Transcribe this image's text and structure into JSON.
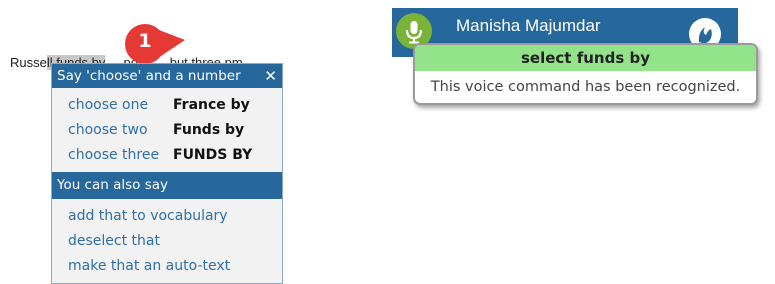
{
  "document": {
    "text_before": "Russe",
    "text_highlight": "ll funds by",
    "text_after": " ... point ... but three pm"
  },
  "callout": {
    "number": "1",
    "color": "#e53935"
  },
  "choice_menu": {
    "title": "Say 'choose' and a number",
    "close_glyph": "✕",
    "choices": [
      {
        "command": "choose one",
        "value": "France by"
      },
      {
        "command": "choose two",
        "value": "Funds by"
      },
      {
        "command": "choose three",
        "value": "FUNDS BY"
      }
    ],
    "also_header": "You can also say",
    "also_options": [
      "add that to vocabulary",
      "deselect that",
      "make that an auto-text"
    ]
  },
  "dragon_bar": {
    "user_name": "Manisha Majumdar",
    "mic_icon": "microphone-icon",
    "logo_icon": "dragon-logo-icon",
    "accent_color": "#26679c",
    "mic_color": "#7bb338"
  },
  "recognition": {
    "command": "select funds by",
    "status": "This voice command has been recognized.",
    "highlight_color": "#93e38b"
  }
}
